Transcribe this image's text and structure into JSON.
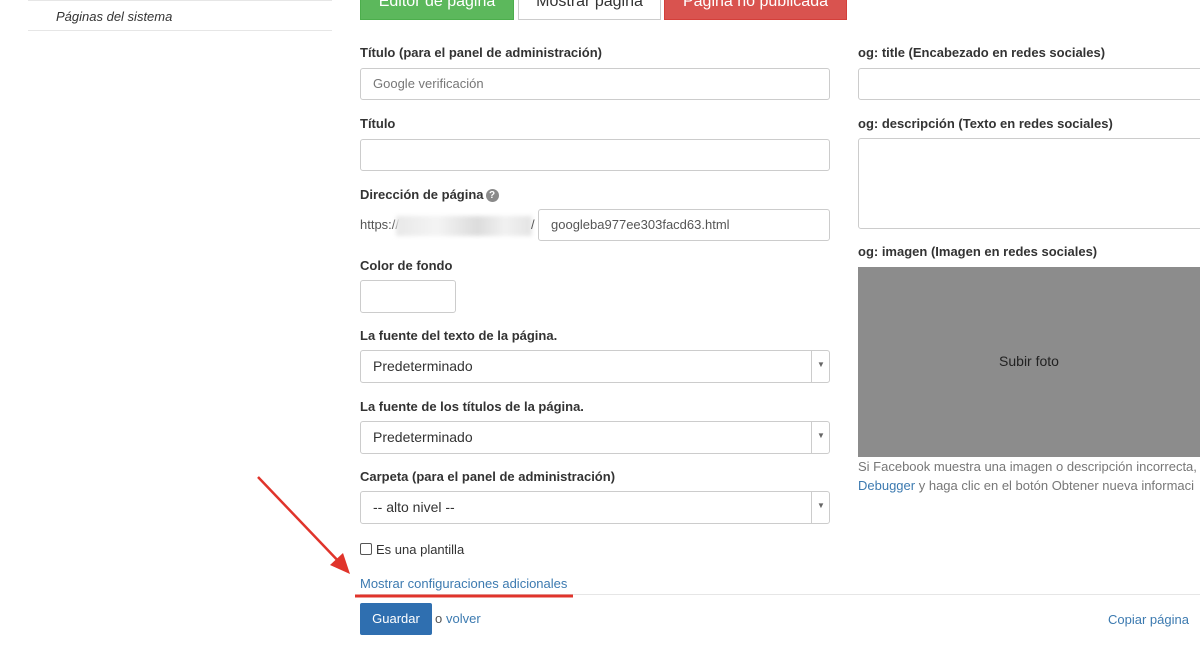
{
  "sidebar": {
    "item_label": "Páginas del sistema"
  },
  "top_buttons": {
    "editor": "Editor de página",
    "show": "Mostrar página",
    "unpublished": "Página no publicada"
  },
  "form": {
    "admin_title_label": "Título (para el panel de administración)",
    "admin_title_placeholder": "Google verificación",
    "title_label": "Título",
    "title_value": "",
    "address_label": "Dirección de página",
    "address_prefix": "https://",
    "address_slash": "/",
    "address_value": "googleba977ee303facd63.html",
    "bg_color_label": "Color de fondo",
    "text_font_label": "La fuente del texto de la página.",
    "text_font_value": "Predeterminado",
    "heading_font_label": "La fuente de los títulos de la página.",
    "heading_font_value": "Predeterminado",
    "folder_label": "Carpeta (para el panel de administración)",
    "folder_value": "-- alto nivel --",
    "template_label": "Es una plantilla",
    "template_checked": false,
    "more_settings_link": "Mostrar configuraciones adicionales"
  },
  "social": {
    "og_title_label": "og: title (Encabezado en redes sociales)",
    "og_desc_label": "og: descripción (Texto en redes sociales)",
    "og_image_label": "og: imagen (Imagen en redes sociales)",
    "upload_label": "Subir foto",
    "hint_line1": "Si Facebook muestra una imagen o descripción incorrecta,",
    "hint_link": "Debugger",
    "hint_line2_rest": " y haga clic en el botón Obtener nueva informaci"
  },
  "actions": {
    "save": "Guardar",
    "or": "o",
    "back": "volver",
    "copy": "Copiar página"
  },
  "colors": {
    "primary": "#2f6fb0",
    "link": "#3c7ab0",
    "annotation_red": "#e0342b",
    "green": "#5cb85c",
    "red": "#d9534f"
  }
}
